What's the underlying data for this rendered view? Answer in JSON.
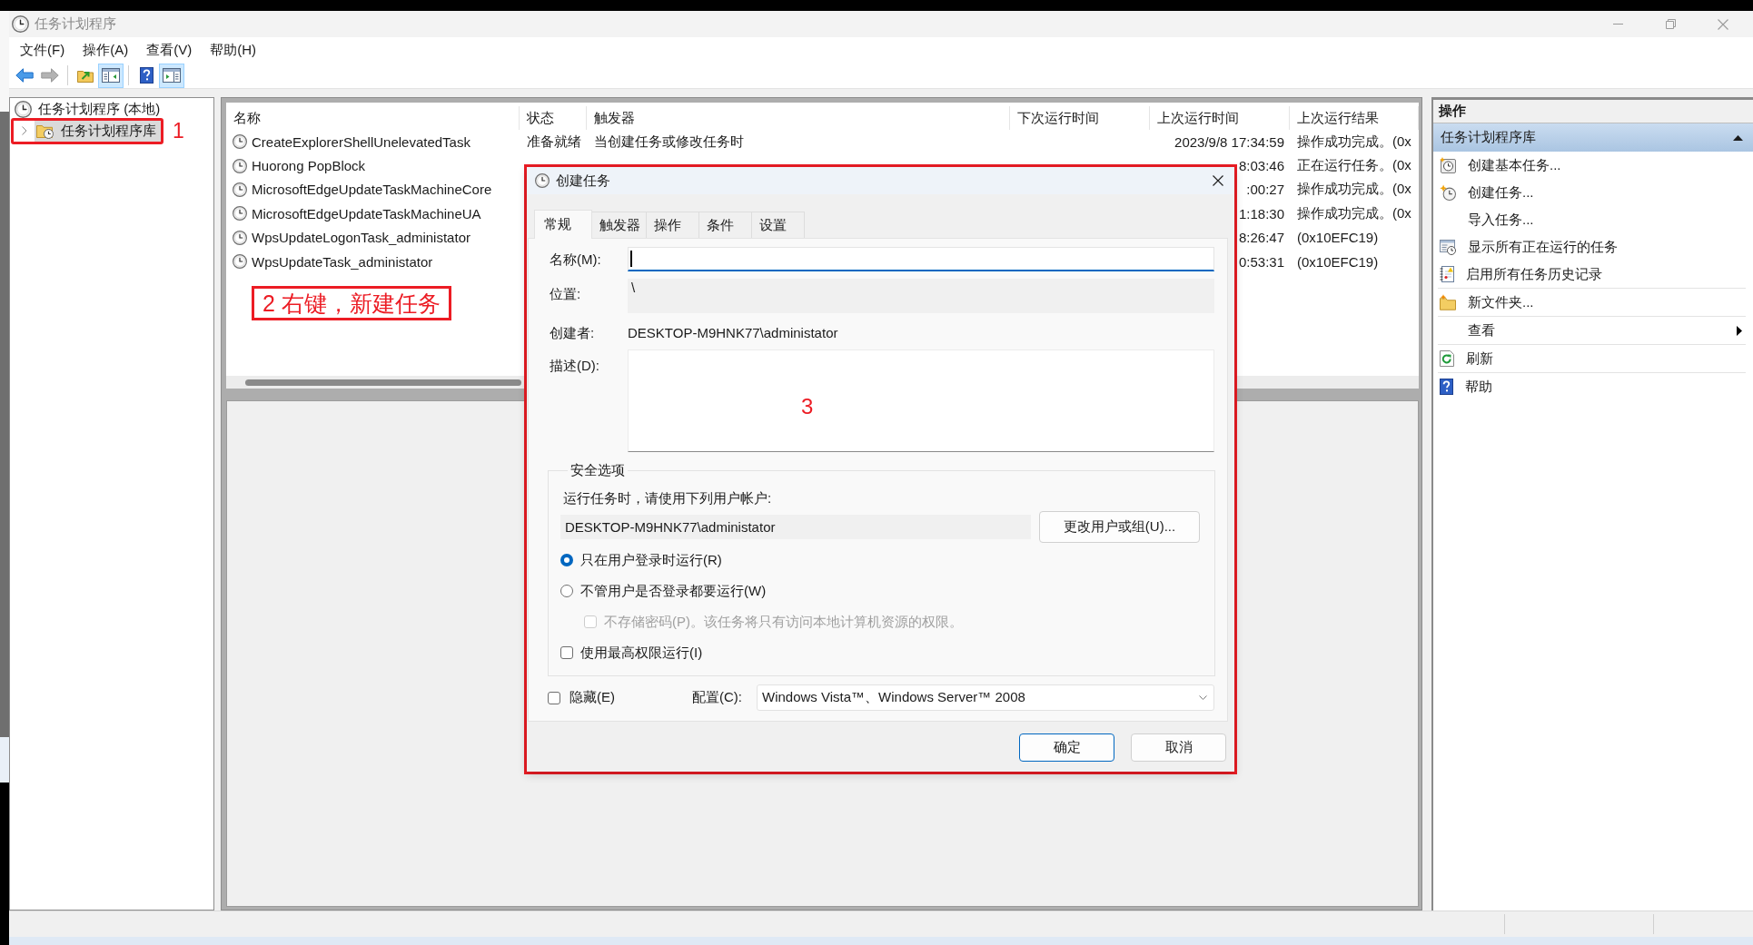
{
  "window": {
    "title": "任务计划程序"
  },
  "menu_bar": [
    {
      "label": "文件(F)"
    },
    {
      "label": "操作(A)"
    },
    {
      "label": "查看(V)"
    },
    {
      "label": "帮助(H)"
    }
  ],
  "toolbar": [
    {
      "kind": "back",
      "disabled": false,
      "on": false
    },
    {
      "kind": "forward",
      "disabled": true,
      "on": false
    },
    {
      "kind": "separator"
    },
    {
      "kind": "up-folder",
      "disabled": false,
      "on": false
    },
    {
      "kind": "console-tree",
      "disabled": false,
      "on": true
    },
    {
      "kind": "separator"
    },
    {
      "kind": "help",
      "disabled": false,
      "on": false
    },
    {
      "kind": "action-pane",
      "disabled": false,
      "on": true
    }
  ],
  "tree": {
    "items": [
      {
        "label": "任务计划程序 (本地)",
        "selected": false,
        "outlined": false,
        "children": [
          {
            "label": "任务计划程序库",
            "selected": true,
            "expanded": false,
            "outlined": true,
            "annotation": "1"
          }
        ]
      }
    ]
  },
  "table": {
    "columns": [
      "名称",
      "状态",
      "触发器",
      "下次运行时间",
      "上次运行时间",
      "上次运行结果"
    ],
    "rows": [
      {
        "name": "CreateExplorerShellUnelevatedTask",
        "status": "准备就绪",
        "trigger": "当创建任务或修改任务时",
        "last_run": "2023/9/8 17:34:59",
        "last_result": "操作成功完成。(0x"
      },
      {
        "name": "Huorong PopBlock",
        "last_run": "8:03:46",
        "last_result": "正在运行任务。(0x"
      },
      {
        "name": "MicrosoftEdgeUpdateTaskMachineCore",
        "last_run": ":00:27",
        "last_result": "操作成功完成。(0x"
      },
      {
        "name": "MicrosoftEdgeUpdateTaskMachineUA",
        "last_run": "1:18:30",
        "last_result": "操作成功完成。(0x"
      },
      {
        "name": "WpsUpdateLogonTask_administator",
        "last_run": "8:26:47",
        "last_result": "(0x10EFC19)"
      },
      {
        "name": "WpsUpdateTask_administator",
        "last_run": "0:53:31",
        "last_result": "(0x10EFC19)"
      }
    ],
    "callout": "2 右键，新建任务"
  },
  "actions_pane": {
    "title": "操作",
    "section": {
      "title": "任务计划程序库",
      "expanded": true
    },
    "groups": [
      {
        "items": [
          {
            "kind": "basic-task",
            "label": "创建基本任务..."
          },
          {
            "kind": "task",
            "label": "创建任务..."
          },
          {
            "kind": "plain",
            "label": "导入任务..."
          },
          {
            "kind": "running",
            "label": "显示所有正在运行的任务"
          },
          {
            "kind": "history",
            "label": "启用所有任务历史记录"
          }
        ]
      },
      {
        "items": [
          {
            "kind": "folder",
            "label": "新文件夹..."
          }
        ]
      },
      {
        "items": [
          {
            "kind": "submenu",
            "label": "查看"
          }
        ]
      },
      {
        "items": [
          {
            "kind": "refresh",
            "label": "刷新"
          }
        ]
      },
      {
        "items": [
          {
            "kind": "help",
            "label": "帮助"
          }
        ]
      }
    ]
  },
  "dialog": {
    "title": "创建任务",
    "outlined": true,
    "tabs": [
      {
        "label": "常规",
        "selected": true
      },
      {
        "label": "触发器",
        "selected": false
      },
      {
        "label": "操作",
        "selected": false
      },
      {
        "label": "条件",
        "selected": false
      },
      {
        "label": "设置",
        "selected": false
      }
    ],
    "general": {
      "name": {
        "label": "名称(M):",
        "focused": true
      },
      "location": {
        "label": "位置:",
        "value": "\\"
      },
      "author": {
        "label": "创建者:",
        "value": "DESKTOP-M9HNK77\\administator"
      },
      "description": {
        "label": "描述(D):",
        "annotation": "3"
      },
      "security": {
        "title": "安全选项",
        "prompt": "运行任务时，请使用下列用户帐户:",
        "account": "DESKTOP-M9HNK77\\administator",
        "change_button": "更改用户或组(U)...",
        "options": [
          {
            "kind": "radio",
            "label": "只在用户登录时运行(R)",
            "selected": true,
            "disabled": false
          },
          {
            "kind": "radio",
            "label": "不管用户是否登录都要运行(W)",
            "selected": false,
            "disabled": false,
            "children": [
              {
                "kind": "checkbox",
                "label": "不存储密码(P)。该任务将只有访问本地计算机资源的权限。",
                "checked": false,
                "disabled": true
              }
            ]
          },
          {
            "kind": "checkbox",
            "label": "使用最高权限运行(I)",
            "checked": false,
            "disabled": false
          }
        ]
      },
      "hidden": {
        "label": "隐藏(E)",
        "checked": false
      },
      "configure": {
        "label": "配置(C):",
        "value": "Windows Vista™、Windows Server™ 2008"
      }
    },
    "buttons": [
      {
        "label": "确定",
        "default": true
      },
      {
        "label": "取消",
        "default": false
      }
    ]
  }
}
